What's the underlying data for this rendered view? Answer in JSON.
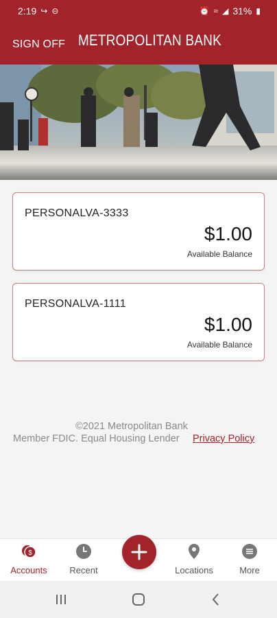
{
  "status_bar": {
    "time": "2:19",
    "battery": "31%"
  },
  "header": {
    "sign_off": "SIGN OFF",
    "title": "METROPOLITAN BANK"
  },
  "accounts": [
    {
      "name": "PERSONALVA-3333",
      "balance": "$1.00",
      "balance_label": "Available Balance"
    },
    {
      "name": "PERSONALVA-1111",
      "balance": "$1.00",
      "balance_label": "Available Balance"
    }
  ],
  "footer": {
    "copyright": "©2021 Metropolitan Bank",
    "fdic": "Member FDIC. Equal Housing Lender",
    "privacy": "Privacy Policy"
  },
  "nav": {
    "accounts": "Accounts",
    "recent": "Recent",
    "locations": "Locations",
    "more": "More",
    "add_icon": "plus-icon"
  },
  "colors": {
    "brand": "#a3232b",
    "nav_icon": "#777777"
  }
}
